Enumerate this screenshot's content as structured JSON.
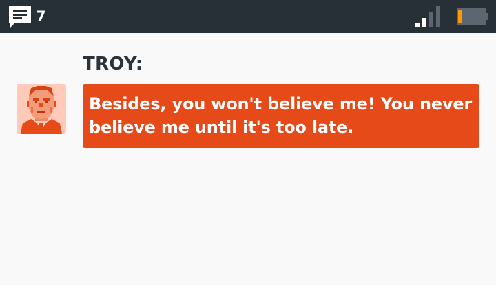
{
  "status_bar": {
    "message_count": "7",
    "icons": {
      "messages": "message-icon",
      "signal": "signal-icon",
      "battery": "battery-icon"
    }
  },
  "dialogue": {
    "speaker": "TROY:",
    "text": "Besides, you won't believe me! You never believe me until it's too late.",
    "avatar": "troy-portrait"
  },
  "colors": {
    "status_bar_bg": "#272f37",
    "bubble_bg": "#e64a19",
    "page_bg": "#f9f9f9",
    "battery_level": "#ff9800",
    "name_text": "#2b333b"
  },
  "battery_level_fraction": 0.15
}
